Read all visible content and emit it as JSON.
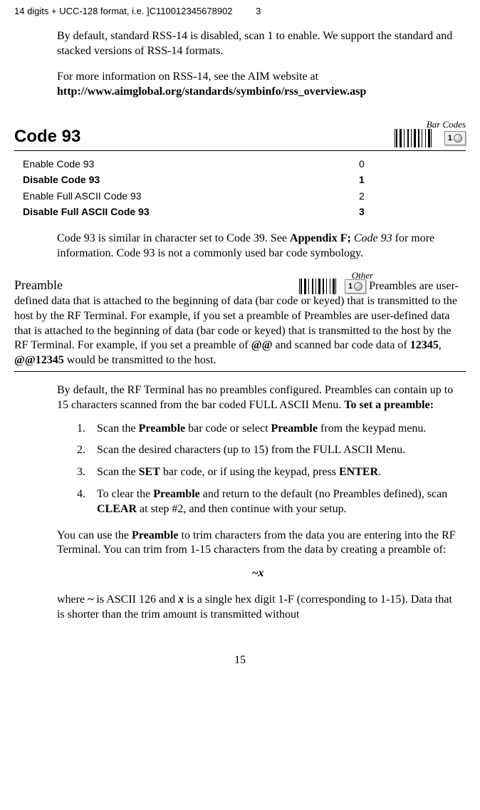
{
  "topLine": {
    "prefix": "14 digits  + UCC-128 format, i.e.  ]C110012345678902",
    "suffix": "3"
  },
  "rss": {
    "para1": "By default, standard RSS-14 is disabled, scan 1 to enable. We support the standard and stacked versions of RSS-14 formats.",
    "para2_lead": "For more information on RSS-14, see the AIM website at",
    "para2_url": "http://www.aimglobal.org/standards/symbinfo/rss_overview.asp"
  },
  "code93": {
    "title": "Code 93",
    "tag": "Bar Codes",
    "badge": "1",
    "options": [
      {
        "label": "Enable Code 93",
        "value": "0",
        "bold": false
      },
      {
        "label": "Disable Code 93",
        "value": "1",
        "bold": true
      },
      {
        "label": "Enable Full ASCII Code 93",
        "value": "2",
        "bold": false
      },
      {
        "label": "Disable Full ASCII Code 93",
        "value": "3",
        "bold": true
      }
    ],
    "desc_pre": "Code 93 is similar in character set to Code 39.  See ",
    "desc_bold": "Appendix F;",
    "desc_italic": " Code 93",
    "desc_post": " for more information.  Code 93 is not a commonly used bar code symbology."
  },
  "preamble": {
    "title": "Preamble",
    "tag": "Other",
    "badge": "1",
    "intro_a": "Preambles are user-defined data that is attached to the beginning of data (bar code or keyed) that is transmitted to the host by the RF Terminal. For example, if you set a preamble of ",
    "intro_at1": "@@",
    "intro_b": " and scanned bar code data of ",
    "intro_num": "12345",
    "intro_c": ", ",
    "intro_at2": "@@12345",
    "intro_d": " would be transmitted to the host.",
    "config_a": "By default, the RF Terminal has no preambles configured.  Preambles can contain up to 15 characters scanned from the bar coded FULL ASCII Menu. ",
    "config_bold": "To set a preamble:",
    "steps": {
      "s1_a": "Scan the ",
      "s1_b": "Preamble",
      "s1_c": " bar code or select ",
      "s1_d": "Preamble",
      "s1_e": " from the keypad menu.",
      "s2": "Scan the desired characters (up to 15) from the FULL ASCII Menu.",
      "s3_a": "Scan the ",
      "s3_b": "SET",
      "s3_c": " bar code, or if using the keypad, press ",
      "s3_d": "ENTER",
      "s3_e": ".",
      "s4_a": "To clear the ",
      "s4_b": "Preamble",
      "s4_c": " and return to the default (no Preambles defined), scan ",
      "s4_d": "CLEAR",
      "s4_e": " at step #2, and then continue with your setup."
    },
    "trim_a": "You can use the ",
    "trim_b": "Preamble",
    "trim_c": " to trim characters from the data you are entering into the RF Terminal. You can trim from 1-15 characters from the data by creating a preamble of:",
    "formula": "~x",
    "where_a": "where ",
    "where_tilde": "~",
    "where_b": " is ASCII 126 and ",
    "where_x": "x",
    "where_c": " is a single hex digit 1-F (corresponding to 1-15).  Data that is shorter than the trim amount is transmitted without"
  },
  "pageNumber": "15"
}
